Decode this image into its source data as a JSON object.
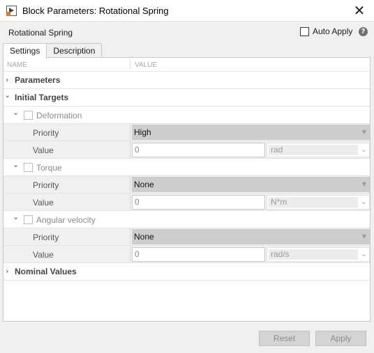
{
  "window": {
    "title": "Block Parameters: Rotational Spring",
    "close_glyph": "✕",
    "app_icon": "simulink-block-icon"
  },
  "block": {
    "name": "Rotational Spring"
  },
  "auto_apply": {
    "label": "Auto Apply",
    "checked": false
  },
  "help_glyph": "?",
  "tabs": [
    {
      "label": "Settings",
      "active": true
    },
    {
      "label": "Description",
      "active": false
    }
  ],
  "columns": {
    "name": "NAME",
    "value": "VALUE"
  },
  "sections": {
    "parameters": {
      "label": "Parameters",
      "expanded": false
    },
    "initial_targets": {
      "label": "Initial Targets",
      "expanded": true
    },
    "nominal_values": {
      "label": "Nominal Values",
      "expanded": false
    }
  },
  "targets": [
    {
      "label": "Deformation",
      "checked": false,
      "priority_label": "Priority",
      "priority": "High",
      "value_label": "Value",
      "value": "0",
      "unit": "rad"
    },
    {
      "label": "Torque",
      "checked": false,
      "priority_label": "Priority",
      "priority": "None",
      "value_label": "Value",
      "value": "0",
      "unit": "N*m"
    },
    {
      "label": "Angular velocity",
      "checked": false,
      "priority_label": "Priority",
      "priority": "None",
      "value_label": "Value",
      "value": "0",
      "unit": "rad/s"
    }
  ],
  "buttons": {
    "reset": "Reset",
    "apply": "Apply"
  },
  "glyphs": {
    "collapsed": "›",
    "expanded": "⌄",
    "dropdown": "▼",
    "unit_dropdown": "⌄"
  }
}
